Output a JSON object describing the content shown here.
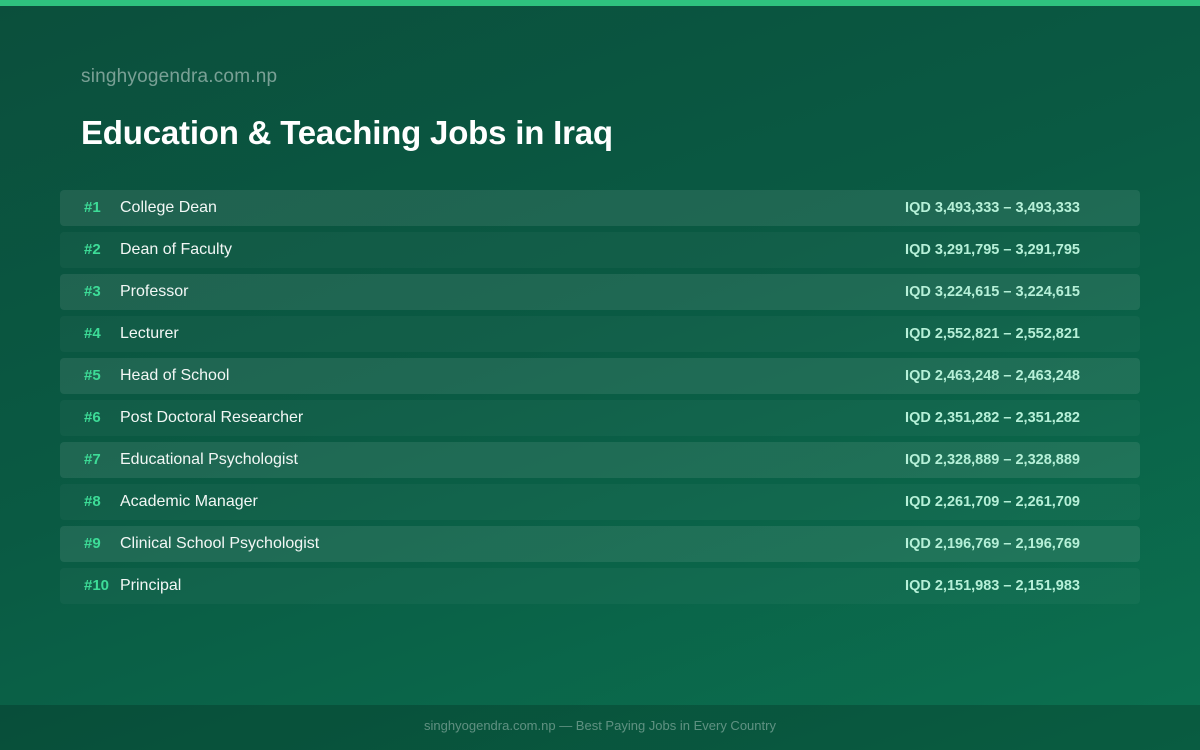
{
  "header": {
    "site_name": "singhyogendra.com.np",
    "title": "Education & Teaching Jobs in Iraq"
  },
  "jobs": [
    {
      "rank": "#1",
      "title": "College Dean",
      "salary": "IQD 3,493,333 – 3,493,333"
    },
    {
      "rank": "#2",
      "title": "Dean of Faculty",
      "salary": "IQD 3,291,795 – 3,291,795"
    },
    {
      "rank": "#3",
      "title": "Professor",
      "salary": "IQD 3,224,615 – 3,224,615"
    },
    {
      "rank": "#4",
      "title": "Lecturer",
      "salary": "IQD 2,552,821 – 2,552,821"
    },
    {
      "rank": "#5",
      "title": "Head of School",
      "salary": "IQD 2,463,248 – 2,463,248"
    },
    {
      "rank": "#6",
      "title": "Post Doctoral Researcher",
      "salary": "IQD 2,351,282 – 2,351,282"
    },
    {
      "rank": "#7",
      "title": "Educational Psychologist",
      "salary": "IQD 2,328,889 – 2,328,889"
    },
    {
      "rank": "#8",
      "title": "Academic Manager",
      "salary": "IQD 2,261,709 – 2,261,709"
    },
    {
      "rank": "#9",
      "title": "Clinical School Psychologist",
      "salary": "IQD 2,196,769 – 2,196,769"
    },
    {
      "rank": "#10",
      "title": "Principal",
      "salary": "IQD 2,151,983 – 2,151,983"
    }
  ],
  "footer": {
    "text": "singhyogendra.com.np — Best Paying Jobs in Every Country"
  },
  "colors": {
    "accent": "#2ec27e",
    "rank": "#3ddc97",
    "salary": "#b6f0d8",
    "background_start": "#0b4f3c",
    "background_end": "#0b7150"
  }
}
